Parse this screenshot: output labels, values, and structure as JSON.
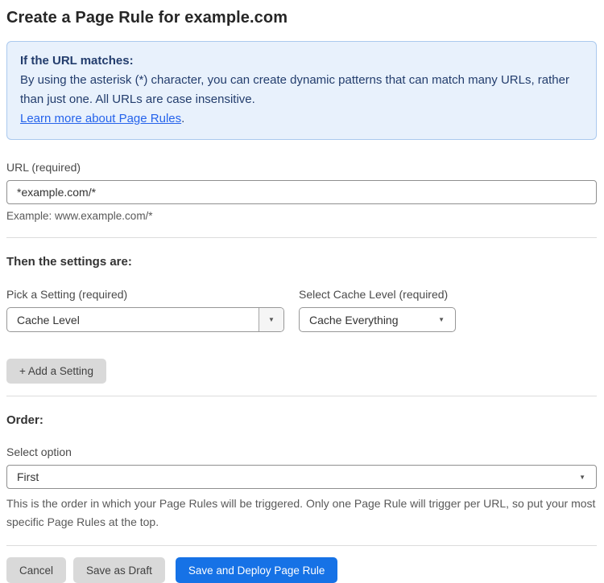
{
  "page": {
    "title": "Create a Page Rule for example.com"
  },
  "info_box": {
    "heading": "If the URL matches:",
    "body": "By using the asterisk (*) character, you can create dynamic patterns that can match many URLs, rather than just one. All URLs are case insensitive.",
    "link_label": "Learn more about Page Rules",
    "link_suffix": "."
  },
  "url_field": {
    "label": "URL (required)",
    "value": "*example.com/*",
    "helper": "Example: www.example.com/*"
  },
  "settings": {
    "heading": "Then the settings are:",
    "setting_picker": {
      "label": "Pick a Setting (required)",
      "selected": "Cache Level"
    },
    "cache_level_picker": {
      "label": "Select Cache Level (required)",
      "selected": "Cache Everything"
    },
    "add_setting_label": "+ Add a Setting"
  },
  "order": {
    "heading": "Order:",
    "label": "Select option",
    "selected": "First",
    "helper": "This is the order in which your Page Rules will be triggered. Only one Page Rule will trigger per URL, so put your most specific Page Rules at the top."
  },
  "actions": {
    "cancel_label": "Cancel",
    "save_draft_label": "Save as Draft",
    "save_deploy_label": "Save and Deploy Page Rule"
  },
  "icons": {
    "dropdown_arrow": "▼"
  },
  "colors": {
    "accent_blue": "#1672e6",
    "info_bg": "#e8f1fc",
    "info_border": "#abc9ee",
    "info_text": "#233d6d",
    "link": "#2563eb"
  }
}
